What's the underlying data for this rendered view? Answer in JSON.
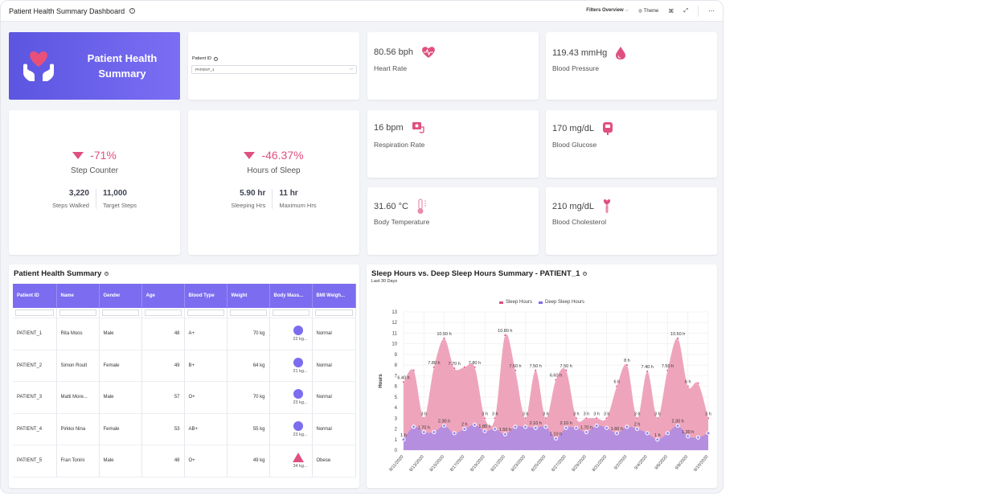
{
  "topbar": {
    "title": "Patient Health Summary Dashboard",
    "filters_label": "Filters Overview",
    "theme_label": "Theme",
    "icons": [
      "info-icon",
      "chevron-down-icon",
      "theme-icon",
      "binoculars-icon",
      "expand-icon",
      "more-icon"
    ]
  },
  "hero": {
    "title": "Patient Health Summary",
    "icon": "hands-heart-icon"
  },
  "patient_filter": {
    "label": "Patient ID",
    "selected": "PATIENT_1"
  },
  "metrics": [
    {
      "value": "80.56 bph",
      "name": "Heart Rate",
      "icon": "heart-pulse-icon"
    },
    {
      "value": "119.43 mmHg",
      "name": "Blood Pressure",
      "icon": "blood-drop-icon"
    },
    {
      "value": "16 bpm",
      "name": "Respiration Rate",
      "icon": "respirator-icon"
    },
    {
      "value": "170 mg/dL",
      "name": "Blood Glucose",
      "icon": "glucometer-icon"
    },
    {
      "value": "31.60 °C",
      "name": "Body Temperature",
      "icon": "thermometer-icon"
    },
    {
      "value": "210 mg/dL",
      "name": "Blood Cholesterol",
      "icon": "cholesterol-icon"
    }
  ],
  "kpis": [
    {
      "change": "-71%",
      "name": "Step Counter",
      "left_value": "3,220",
      "left_label": "Steps Walked",
      "right_value": "11,000",
      "right_label": "Target Steps"
    },
    {
      "change": "-46.37%",
      "name": "Hours of Sleep",
      "left_value": "5.90 hr",
      "left_label": "Sleeping Hrs",
      "right_value": "11 hr",
      "right_label": "Maximum Hrs"
    }
  ],
  "table": {
    "title": "Patient Health Summary",
    "columns": [
      "Patient ID",
      "Name",
      "Gender",
      "Age",
      "Blood Type",
      "Weight",
      "Body Mass...",
      "BMI Weigh..."
    ],
    "rows": [
      {
        "id": "PATIENT_1",
        "name": "Rita Moos",
        "gender": "Male",
        "age": "48",
        "blood": "A+",
        "weight": "70 kg",
        "bmi": "22 kg...",
        "bmi_shape": "circle",
        "bmi_class": "Normal"
      },
      {
        "id": "PATIENT_2",
        "name": "Simon Roult",
        "gender": "Female",
        "age": "49",
        "blood": "B+",
        "weight": "64 kg",
        "bmi": "21 kg...",
        "bmi_shape": "circle",
        "bmi_class": "Normal"
      },
      {
        "id": "PATIENT_3",
        "name": "Matti More...",
        "gender": "Male",
        "age": "57",
        "blood": "O+",
        "weight": "70 kg",
        "bmi": "23 kg...",
        "bmi_shape": "circle",
        "bmi_class": "Normal"
      },
      {
        "id": "PATIENT_4",
        "name": "Pirkko Nina",
        "gender": "Female",
        "age": "53",
        "blood": "AB+",
        "weight": "55 kg",
        "bmi": "23 kg...",
        "bmi_shape": "circle",
        "bmi_class": "Normal"
      },
      {
        "id": "PATIENT_5",
        "name": "Fran Tonini",
        "gender": "Male",
        "age": "48",
        "blood": "O+",
        "weight": "49 kg",
        "bmi": "34 kg...",
        "bmi_shape": "triangle",
        "bmi_class": "Obese"
      }
    ]
  },
  "chart_panel": {
    "title": "Sleep Hours vs. Deep Sleep Hours Summary  -  PATIENT_1",
    "subtitle": "Last 30 Days"
  },
  "chart_data": {
    "type": "area",
    "title": "Sleep Hours vs. Deep Sleep Hours Summary - PATIENT_1",
    "subtitle": "Last 30 Days",
    "xlabel": "",
    "ylabel": "Hours",
    "ylim": [
      0,
      13
    ],
    "yticks": [
      0,
      1,
      2,
      3,
      4,
      5,
      6,
      7,
      8,
      9,
      10,
      11,
      12,
      13
    ],
    "grid": true,
    "legend_position": "top-center",
    "x": [
      "8/11/2020",
      "8/12/2020",
      "8/13/2020",
      "8/14/2020",
      "8/15/2020",
      "8/16/2020",
      "8/17/2020",
      "8/18/2020",
      "8/19/2020",
      "8/20/2020",
      "8/21/2020",
      "8/22/2020",
      "8/23/2020",
      "8/24/2020",
      "8/25/2020",
      "8/26/2020",
      "8/27/2020",
      "8/28/2020",
      "8/29/2020",
      "8/30/2020",
      "8/31/2020",
      "9/1/2020",
      "9/2/2020",
      "9/3/2020",
      "9/4/2020",
      "9/5/2020",
      "9/6/2020",
      "9/7/2020",
      "9/8/2020",
      "9/9/2020",
      "9/10/2020"
    ],
    "xticks": [
      "8/11/2020",
      "8/13/2020",
      "8/15/2020",
      "8/17/2020",
      "8/19/2020",
      "8/21/2020",
      "8/23/2020",
      "8/25/2020",
      "8/27/2020",
      "8/29/2020",
      "8/31/2020",
      "9/2/2020",
      "9/4/2020",
      "9/6/2020",
      "9/8/2020",
      "9/10/2020"
    ],
    "series": [
      {
        "name": "Sleep Hours",
        "color": "#ec9bb5",
        "marker": "#e0507e",
        "values": [
          6.4,
          7.5,
          3,
          7.8,
          10.5,
          7.7,
          7.8,
          7.8,
          3,
          3,
          10.8,
          7.5,
          3,
          7.5,
          3,
          6.6,
          7.5,
          3,
          3,
          3,
          3,
          6,
          8,
          3,
          7.4,
          3,
          7.5,
          10.5,
          6,
          6.3,
          3
        ],
        "labels": [
          "6.40 h",
          "",
          "3 h",
          "7.80 h",
          "10.50 h",
          "7.70 h",
          "",
          "7.80 h",
          "3 h",
          "3 h",
          "10.80 h",
          "7.50 h",
          "3 h",
          "7.50 h",
          "3 h",
          "6.60 h",
          "7.50 h",
          "3 h",
          "3 h",
          "3 h",
          "3 h",
          "6 h",
          "8 h",
          "3 h",
          "7.40 h",
          "3 h",
          "7.50 h",
          "10.50 h",
          "6 h",
          "",
          "3 h"
        ]
      },
      {
        "name": "Deep Sleep Hours",
        "color": "#b58ee0",
        "marker": "#7b6cf0",
        "values": [
          1,
          2.2,
          1.7,
          1.7,
          2.3,
          1.6,
          2,
          2.4,
          1.8,
          2,
          1.5,
          2.2,
          2.2,
          2.1,
          2.2,
          1.1,
          2.1,
          2.1,
          1.7,
          2.3,
          2.1,
          1.6,
          2.2,
          2,
          1.6,
          1,
          1.6,
          2.3,
          1.3,
          1.2,
          1.6
        ],
        "labels": [
          "1 h",
          "",
          "1.70 h",
          "",
          "2.30 h",
          "",
          "2 h",
          "",
          "1.80 h",
          "",
          "1.50 h",
          "",
          "",
          "2.10 h",
          "",
          "1.10 h",
          "2.10 h",
          "",
          "1.70 h",
          "",
          "",
          "1.60 h",
          "",
          "2 h",
          "",
          "1 h",
          "",
          "2.30 h",
          "1.30 h",
          "",
          ""
        ]
      }
    ]
  }
}
